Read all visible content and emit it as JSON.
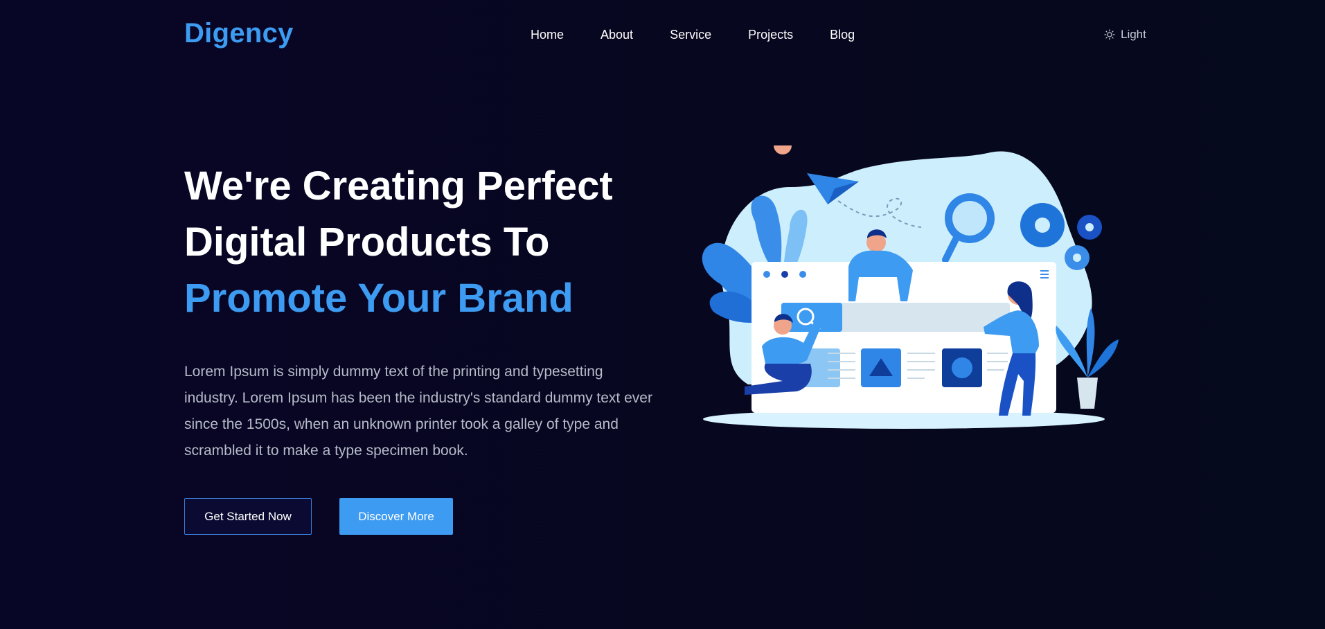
{
  "header": {
    "logo": "Digency",
    "nav": [
      {
        "label": "Home"
      },
      {
        "label": "About"
      },
      {
        "label": "Service"
      },
      {
        "label": "Projects"
      },
      {
        "label": "Blog"
      }
    ],
    "theme_toggle": {
      "label": "Light",
      "icon": "sun-icon"
    }
  },
  "hero": {
    "title_line1": "We're Creating Perfect",
    "title_line2": "Digital Products To",
    "title_line3_accent": "Promote Your Brand",
    "description": "Lorem Ipsum is simply dummy text of the printing and typesetting industry. Lorem Ipsum has been the industry's standard dummy text ever since the 1500s, when an unknown printer took a galley of type and scrambled it to make a type specimen book.",
    "buttons": {
      "get_started": "Get Started Now",
      "discover": "Discover More"
    },
    "illustration": "team-building-website-illustration"
  },
  "colors": {
    "background": "#07071f",
    "accent": "#3d9bf1",
    "text": "#ffffff",
    "muted_text": "#b7bbc9"
  }
}
